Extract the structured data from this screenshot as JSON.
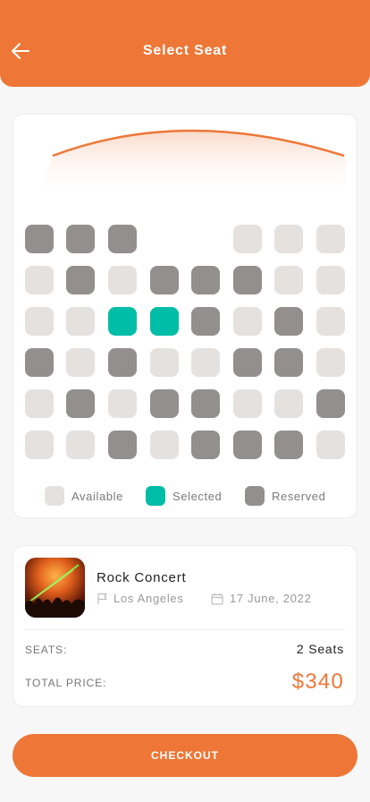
{
  "header": {
    "title": "Select Seat",
    "back_icon": "arrow-left-icon"
  },
  "seat_map": {
    "rows": [
      [
        "reserved",
        "reserved",
        "reserved",
        "",
        "",
        "available",
        "available",
        "available"
      ],
      [
        "available",
        "reserved",
        "available",
        "reserved",
        "reserved",
        "reserved",
        "available",
        "available"
      ],
      [
        "available",
        "available",
        "selected",
        "selected",
        "reserved",
        "available",
        "reserved",
        "available"
      ],
      [
        "reserved",
        "available",
        "reserved",
        "available",
        "available",
        "reserved",
        "reserved",
        "available"
      ],
      [
        "available",
        "reserved",
        "available",
        "reserved",
        "reserved",
        "available",
        "available",
        "reserved"
      ],
      [
        "available",
        "available",
        "reserved",
        "available",
        "reserved",
        "reserved",
        "reserved",
        "available"
      ]
    ],
    "colors": {
      "available": "#e5e1df",
      "selected": "#00bda8",
      "reserved": "#948f8f"
    }
  },
  "legend": {
    "available": "Available",
    "selected": "Selected",
    "reserved": "Reserved"
  },
  "event": {
    "title": "Rock Concert",
    "location": "Los Angeles",
    "date": "17 June, 2022",
    "location_icon": "flag-icon",
    "date_icon": "calendar-icon"
  },
  "summary": {
    "seats_label": "SEATS:",
    "seats_value": "2 Seats",
    "price_label": "TOTAL PRICE:",
    "price_value": "$340"
  },
  "checkout": {
    "label": "CHECKOUT"
  },
  "accent_color": "#ee7737"
}
